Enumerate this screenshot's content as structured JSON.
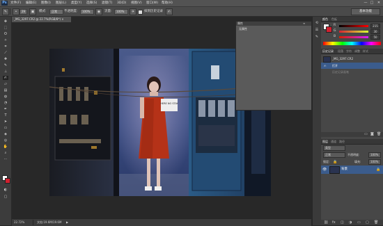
{
  "menubar": {
    "logo": "Ps",
    "items": [
      "文件(F)",
      "编辑(E)",
      "图像(I)",
      "图层(L)",
      "类型(Y)",
      "选择(S)",
      "滤镜(T)",
      "3D(D)",
      "视图(V)",
      "窗口(W)",
      "帮助(H)"
    ],
    "window_controls": {
      "minimize": "—",
      "restore": "□",
      "close": "✕"
    }
  },
  "options": {
    "brush_size": "29",
    "mode_label": "模式:",
    "mode_value": "正常",
    "opacity_label": "不透明度:",
    "opacity_value": "100%",
    "flow_label": "流量:",
    "flow_value": "100%",
    "erase_history_label": "抹到历史记录",
    "workspace": "基本功能"
  },
  "document": {
    "tab_title": "_MG_3297.CR2 @ 22.7%(RGB/8*) ×",
    "close_glyph": "×",
    "sign_text": "HERE NO STAY"
  },
  "properties_panel": {
    "tab": "属性",
    "subtitle": "无属性"
  },
  "status": {
    "zoom": "22.72%",
    "doc_info": "文档:19.6M/19.6M"
  },
  "color_panel": {
    "tabs": [
      "颜色",
      "色板"
    ],
    "sliders": [
      {
        "label": "R",
        "value": "215",
        "fill": "#ff0000"
      },
      {
        "label": "G",
        "value": "30",
        "fill": "#00ff00"
      },
      {
        "label": "B",
        "value": "50",
        "fill": "#0000ff"
      }
    ],
    "foreground": "#ffffff",
    "background": "#d1202f"
  },
  "history_panel": {
    "tabs": [
      "历史记录",
      "段落",
      "字符",
      "调整",
      "样式"
    ],
    "snapshot": "_MG_3297.CR2",
    "items": [
      "打开",
      "历史记录画笔"
    ]
  },
  "layers_panel": {
    "tabs": [
      "图层",
      "通道",
      "路径"
    ],
    "kind_filter": "类型",
    "blend_mode": "正常",
    "opacity_label": "不透明度:",
    "opacity_value": "100%",
    "lock_label": "锁定:",
    "fill_label": "填充:",
    "fill_value": "100%",
    "layer_name": "背景"
  },
  "colors": {
    "accent_selection": "#3b5c8c"
  }
}
